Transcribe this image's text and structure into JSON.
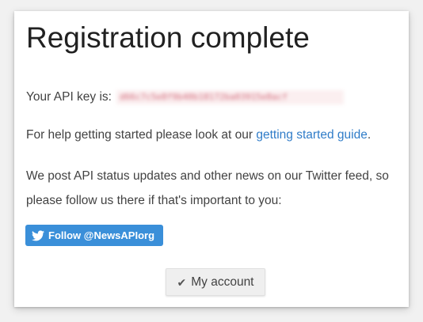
{
  "page": {
    "title": "Registration complete"
  },
  "api_key": {
    "label": "Your API key is:",
    "value": "d66c7c5e8f9b40b18172ba03915e8acf"
  },
  "help": {
    "prefix": "For help getting started please look at our ",
    "link_text": "getting started guide",
    "suffix": "."
  },
  "news": {
    "text": "We post API status updates and other news on our Twitter feed, so please follow us there if that's important to you:"
  },
  "twitter_button": {
    "icon": "twitter-bird-icon",
    "label": "Follow @NewsAPIorg",
    "color": "#3a8fd9"
  },
  "account_button": {
    "icon": "check-icon",
    "icon_glyph": "✔",
    "label": "My account"
  },
  "colors": {
    "link": "#2f7cc8",
    "text": "#424242",
    "title": "#212121"
  }
}
